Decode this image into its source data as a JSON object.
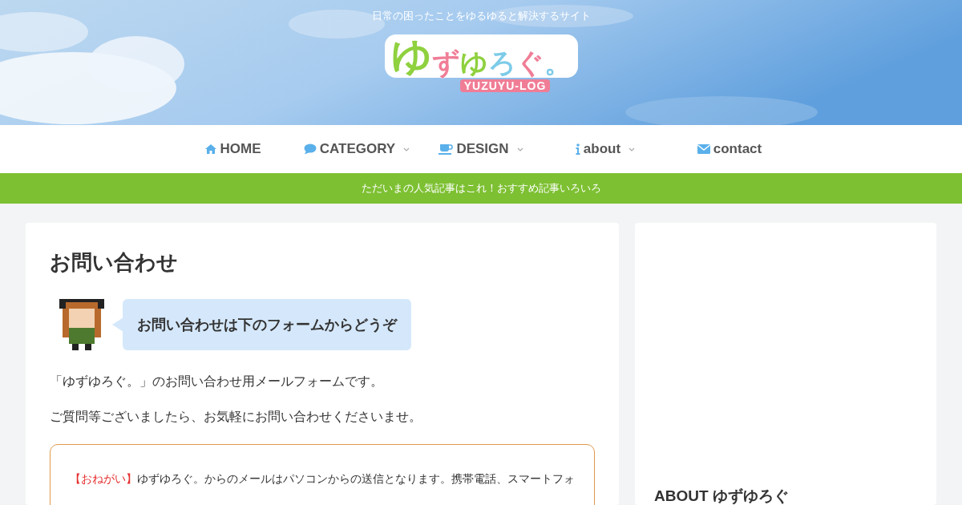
{
  "header": {
    "tagline": "日常の困ったことをゆるゆると解決するサイト",
    "logo": {
      "letters": [
        {
          "text": "ゆ",
          "color": "#8fd13f"
        },
        {
          "text": "ず",
          "color": "#f07d96"
        },
        {
          "text": "ゆ",
          "color": "#8fd13f"
        },
        {
          "text": "ろ",
          "color": "#7ccbe8"
        },
        {
          "text": "ぐ",
          "color": "#f07d96"
        },
        {
          "text": "。",
          "color": "#7ccbe8"
        }
      ],
      "subtitle": "YUZUYU-LOG"
    }
  },
  "nav": [
    {
      "label": "HOME",
      "dropdown": false
    },
    {
      "label": "CATEGORY",
      "dropdown": true
    },
    {
      "label": "DESIGN",
      "dropdown": true
    },
    {
      "label": "about",
      "dropdown": true
    },
    {
      "label": "contact",
      "dropdown": false
    }
  ],
  "notice": "ただいまの人気記事はこれ！おすすめ記事いろいろ",
  "article": {
    "title": "お問い合わせ",
    "speech": "お問い合わせは下のフォームからどうぞ",
    "paragraphs": [
      "「ゆずゆろぐ。」のお問い合わせ用メールフォームです。",
      "ご質問等ございましたら、お気軽にお問い合わせくださいませ。"
    ],
    "note": {
      "tag": "【おねがい】",
      "text": "ゆずゆろぐ。からのメールはパソコンからの送信となります。携帯電話、スマートフォ"
    }
  },
  "sidebar": {
    "heading": "ABOUT ゆずゆろぐ"
  }
}
